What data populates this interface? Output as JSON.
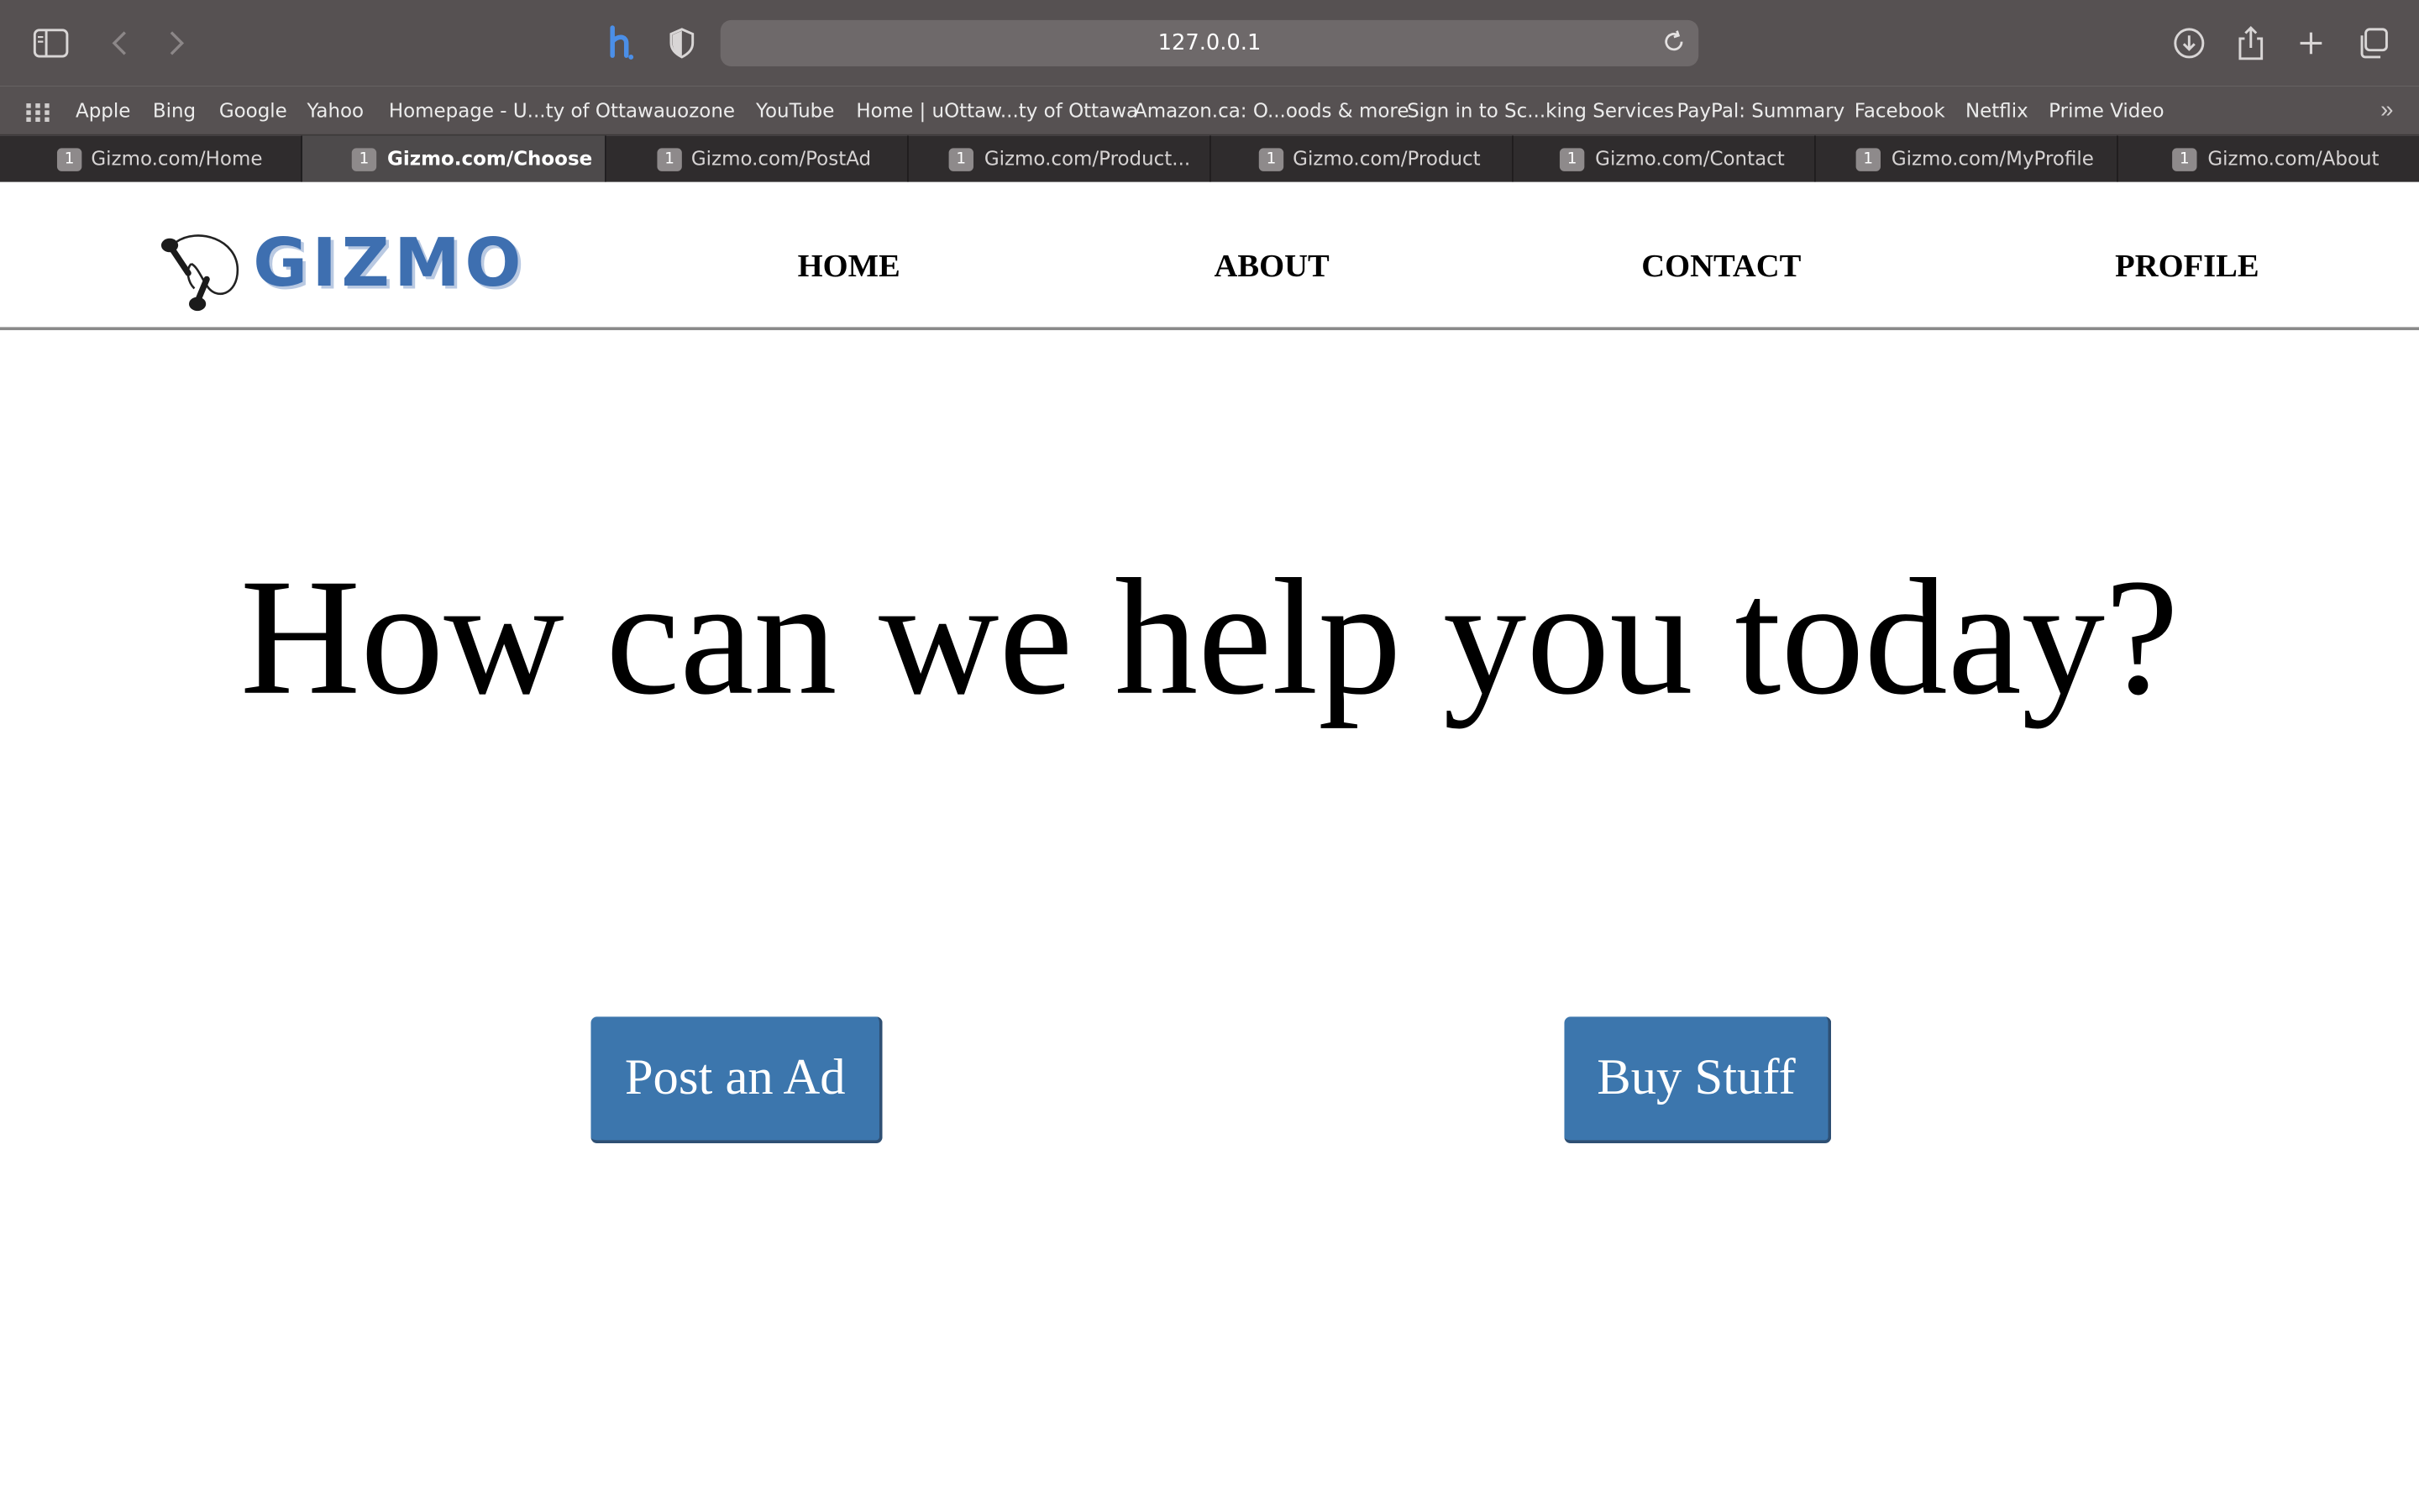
{
  "browser": {
    "url": "127.0.0.1",
    "bookmarks": [
      "Apple",
      "Bing",
      "Google",
      "Yahoo",
      "Homepage - U...ty of Ottawa",
      "uozone",
      "YouTube",
      "Home | uOttaw...ty of Ottawa",
      "Amazon.ca: O...oods & more",
      "Sign in to Sc...king Services",
      "PayPal: Summary",
      "Facebook",
      "Netflix",
      "Prime Video"
    ],
    "tabs": [
      {
        "badge": "1",
        "title": "Gizmo.com/Home"
      },
      {
        "badge": "1",
        "title": "Gizmo.com/Choose"
      },
      {
        "badge": "1",
        "title": "Gizmo.com/PostAd"
      },
      {
        "badge": "1",
        "title": "Gizmo.com/Product..."
      },
      {
        "badge": "1",
        "title": "Gizmo.com/Product"
      },
      {
        "badge": "1",
        "title": "Gizmo.com/Contact"
      },
      {
        "badge": "1",
        "title": "Gizmo.com/MyProfile"
      },
      {
        "badge": "1",
        "title": "Gizmo.com/About"
      }
    ],
    "active_tab": "Gizmo.com/Choose",
    "icons": [
      "sidebar-icon",
      "back-icon",
      "forward-icon",
      "extension-h-icon",
      "shield-icon",
      "reload-icon",
      "download-icon",
      "share-icon",
      "new-tab-icon",
      "tab-overview-icon",
      "bookmarks-grid-icon",
      "more-bookmarks-icon"
    ]
  },
  "site": {
    "logo_text": "GIZMO",
    "logo_color": "#3e6fb0",
    "nav": {
      "home": "HOME",
      "about": "ABOUT",
      "contact": "CONTACT",
      "profile": "PROFILE"
    }
  },
  "main": {
    "headline": "How can we help you today?",
    "post_ad_label": "Post an Ad",
    "buy_label": "Buy Stuff",
    "button_color": "#3c76ad"
  }
}
